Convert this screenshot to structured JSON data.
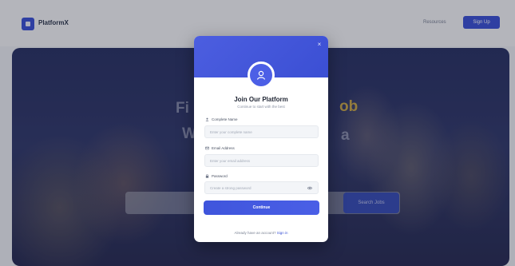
{
  "nav": {
    "brand": "PlatformX",
    "link": "Resources",
    "button": "Sign Up"
  },
  "hero": {
    "title_left_1": "Fi",
    "title_right_1": "ob",
    "title_left_2": "W",
    "title_right_2": "a",
    "search_button": "Search Jobs"
  },
  "modal": {
    "close_icon": "×",
    "avatar_icon": "user-icon",
    "title": "Join Our Platform",
    "subtitle": "Continue to start with the best",
    "fields": [
      {
        "label": "Complete Name",
        "placeholder": "Enter your complete name",
        "icon": "user-icon"
      },
      {
        "label": "Email Address",
        "placeholder": "Enter your email address",
        "icon": "mail-icon"
      },
      {
        "label": "Password",
        "placeholder": "Create a strong password",
        "icon": "lock-icon"
      }
    ],
    "continue_button": "Continue",
    "footer_prefix": "Already have an account? ",
    "footer_link": "Sign in"
  },
  "colors": {
    "accent": "#3d54d6",
    "hero_highlight": "#c9a84a"
  }
}
